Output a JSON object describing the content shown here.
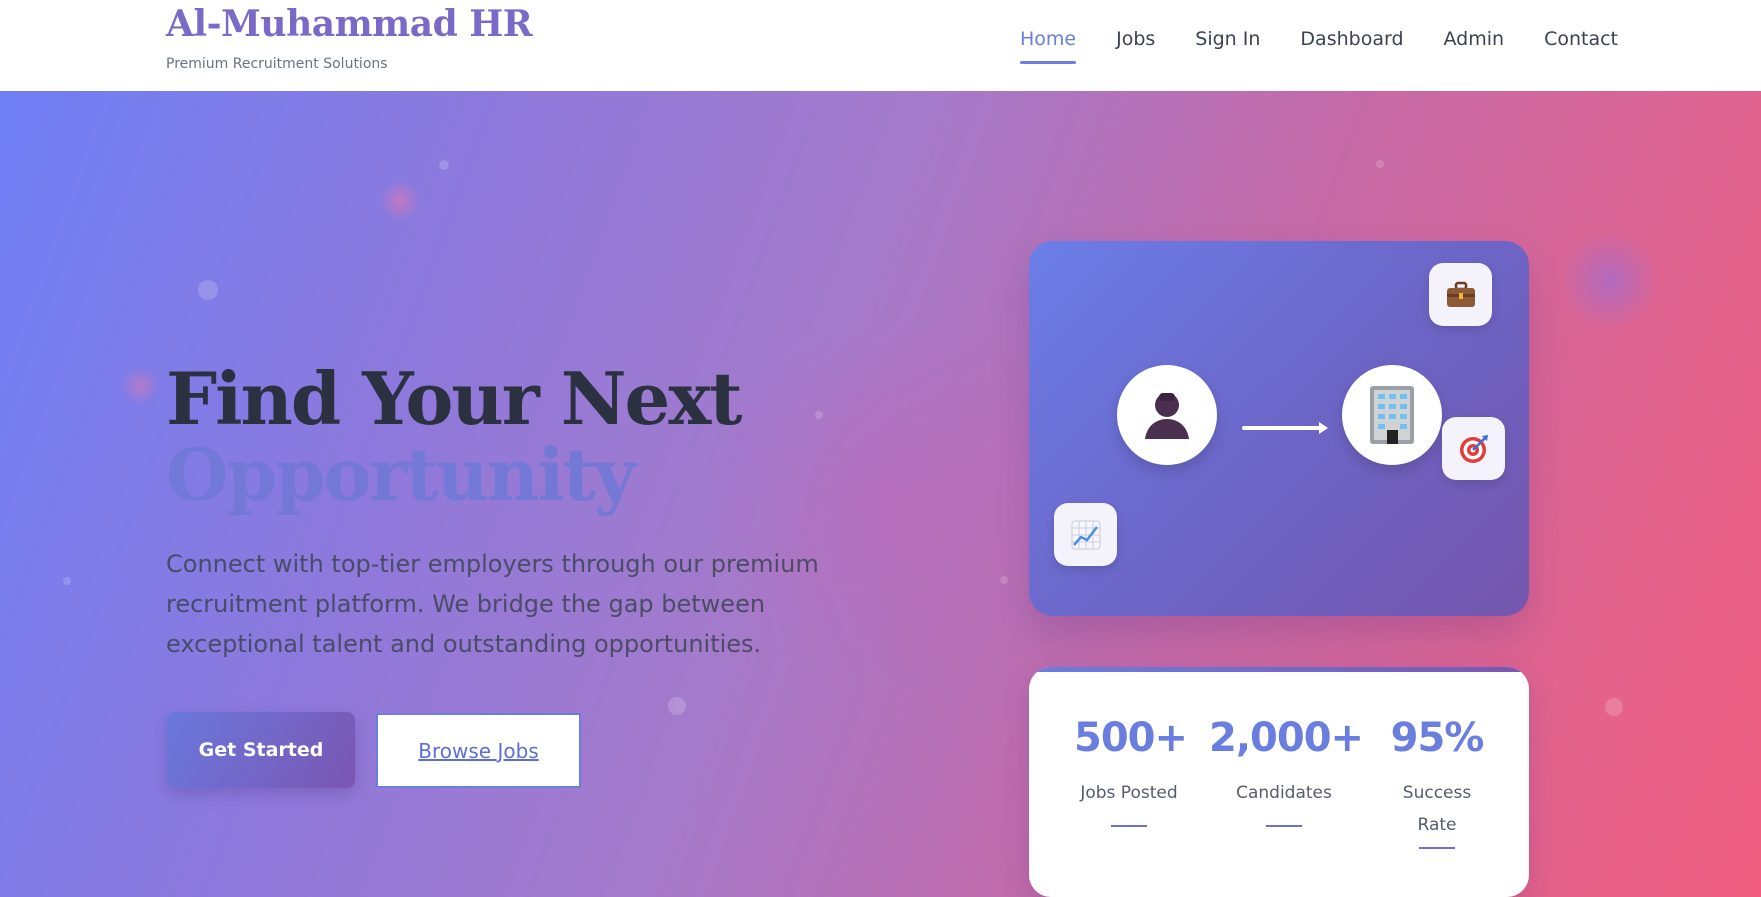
{
  "brand": {
    "name": "Al-Muhammad HR",
    "tagline": "Premium Recruitment Solutions"
  },
  "nav": {
    "items": [
      {
        "label": "Home",
        "active": true
      },
      {
        "label": "Jobs"
      },
      {
        "label": "Sign In"
      },
      {
        "label": "Dashboard"
      },
      {
        "label": "Admin"
      },
      {
        "label": "Contact"
      }
    ]
  },
  "hero": {
    "title_line1": "Find Your Next",
    "title_line2": "Opportunity",
    "lead": "Connect with top-tier employers through our premium recruitment platform. We bridge the gap between exceptional talent and outstanding opportunities.",
    "primary_cta": "Get Started",
    "secondary_cta": "Browse Jobs"
  },
  "illustration": {
    "icons": [
      "person-icon",
      "arrow-icon",
      "office-building-icon",
      "briefcase-icon",
      "target-icon",
      "chart-icon"
    ]
  },
  "stats": [
    {
      "value": "500+",
      "label": "Jobs Posted"
    },
    {
      "value": "2,000+",
      "label": "Candidates"
    },
    {
      "value": "95%",
      "label": "Success Rate"
    }
  ],
  "colors": {
    "accent": "#6a7ee0",
    "brand": "#7a6ac8",
    "hero_start": "#6f7ff5",
    "hero_end": "#f05d80"
  }
}
